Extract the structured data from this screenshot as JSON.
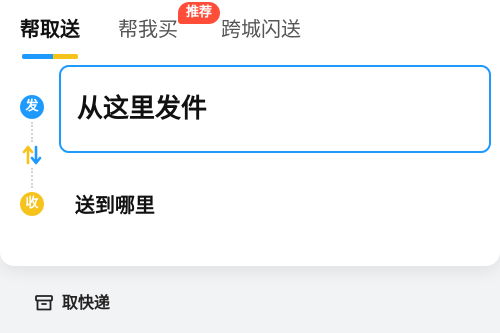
{
  "tabs": [
    {
      "label": "帮取送",
      "active": true
    },
    {
      "label": "帮我买",
      "active": false,
      "badge": "推荐"
    },
    {
      "label": "跨城闪送",
      "active": false
    }
  ],
  "address": {
    "from_marker": "发",
    "from_value": "从这里发件",
    "to_marker": "收",
    "to_value": "送到哪里"
  },
  "bottom": {
    "pickup_label": "取快递"
  },
  "colors": {
    "primary": "#1e9aff",
    "accent": "#f6c21c",
    "badge": "#ff4d3a"
  },
  "icons": [
    "swap-icon",
    "package-box-icon"
  ]
}
